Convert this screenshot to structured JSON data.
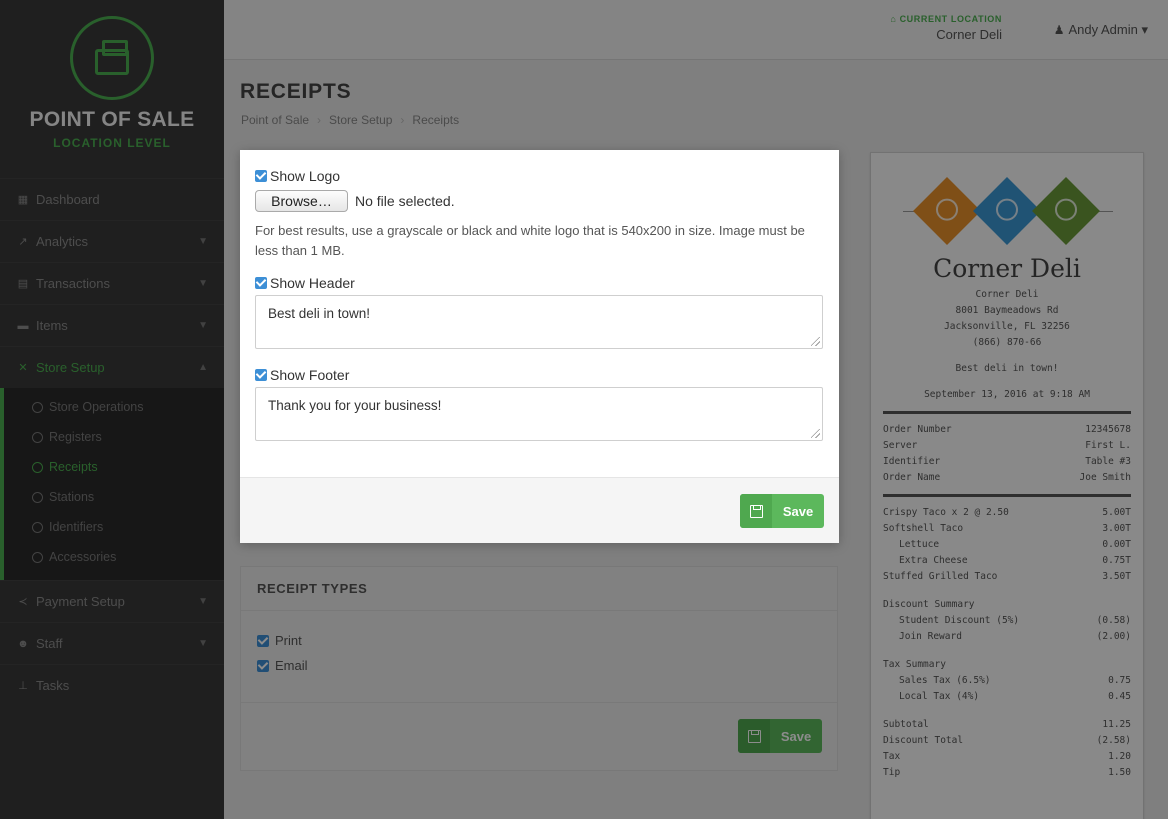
{
  "sidebar": {
    "brand_title": "POINT OF SALE",
    "brand_subtitle": "LOCATION LEVEL",
    "items": [
      {
        "label": "Dashboard",
        "icon": "dashboard-icon"
      },
      {
        "label": "Analytics",
        "icon": "chart-icon"
      },
      {
        "label": "Transactions",
        "icon": "receipt-icon"
      },
      {
        "label": "Items",
        "icon": "cart-icon"
      },
      {
        "label": "Store Setup",
        "icon": "tools-icon"
      },
      {
        "label": "Payment Setup",
        "icon": "share-icon"
      },
      {
        "label": "Staff",
        "icon": "staff-icon"
      },
      {
        "label": "Tasks",
        "icon": "sitemap-icon"
      }
    ],
    "subitems": [
      "Store Operations",
      "Registers",
      "Receipts",
      "Stations",
      "Identifiers",
      "Accessories"
    ]
  },
  "topbar": {
    "location_label": "CURRENT LOCATION",
    "location_name": "Corner Deli",
    "user": "Andy Admin"
  },
  "page": {
    "title": "RECEIPTS",
    "breadcrumb": [
      "Point of Sale",
      "Store Setup",
      "Receipts"
    ],
    "breadcrumb_sep": "›"
  },
  "modal": {
    "show_logo_label": "Show Logo",
    "browse_label": "Browse…",
    "file_status": "No file selected.",
    "help_text": "For best results, use a grayscale or black and white logo that is 540x200 in size. Image must be less than 1 MB.",
    "show_header_label": "Show Header",
    "header_value": "Best deli in town!",
    "show_footer_label": "Show Footer",
    "footer_value": "Thank you for your business!",
    "save_label": "Save"
  },
  "receipt_types": {
    "title": "RECEIPT TYPES",
    "options": [
      "Print",
      "Email"
    ],
    "save_label": "Save"
  },
  "receipt": {
    "title": "Corner Deli",
    "address": [
      "Corner Deli",
      "8001 Baymeadows Rd",
      "Jacksonville, FL 32256",
      "(866) 870-66"
    ],
    "tagline": "Best deli in town!",
    "datetime": "September 13, 2016 at 9:18 AM",
    "info": [
      [
        "Order Number",
        "12345678"
      ],
      [
        "Server",
        "First L."
      ],
      [
        "Identifier",
        "Table #3"
      ],
      [
        "Order Name",
        "Joe Smith"
      ]
    ],
    "lines": [
      [
        "Crispy Taco x 2 @ 2.50",
        "5.00T"
      ],
      [
        "Softshell Taco",
        "3.00T"
      ],
      [
        "Lettuce",
        "0.00T"
      ],
      [
        "Extra Cheese",
        "0.75T"
      ],
      [
        "Stuffed Grilled Taco",
        "3.50T"
      ]
    ],
    "discount_title": "Discount Summary",
    "discounts": [
      [
        "Student Discount (5%)",
        "(0.58)"
      ],
      [
        "Join Reward",
        "(2.00)"
      ]
    ],
    "tax_title": "Tax Summary",
    "taxes": [
      [
        "Sales Tax (6.5%)",
        "0.75"
      ],
      [
        "Local Tax (4%)",
        "0.45"
      ]
    ],
    "totals": [
      [
        "Subtotal",
        "11.25"
      ],
      [
        "Discount Total",
        "(2.58)"
      ],
      [
        "Tax",
        "1.20"
      ],
      [
        "Tip",
        "1.50"
      ]
    ]
  }
}
